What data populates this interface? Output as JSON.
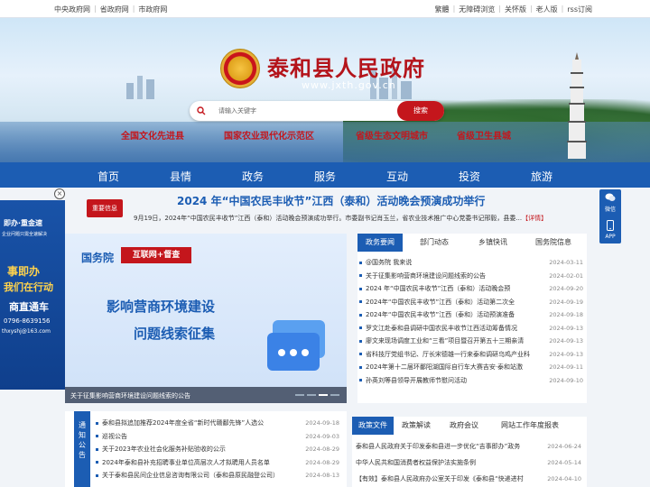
{
  "topbar": {
    "left_links": [
      "中央政府网",
      "省政府网",
      "市政府网"
    ],
    "right_links": [
      "繁體",
      "无障碍浏览",
      "关怀版",
      "老人版",
      "rss订阅"
    ]
  },
  "header": {
    "site_title": "泰和县人民政府",
    "site_url": "www.jxth.gov.cn",
    "search_placeholder": "请输入关键字",
    "search_button": "搜索",
    "slogans": [
      "全国文化先进县",
      "国家农业现代化示范区",
      "省级生态文明城市",
      "省级卫生县城"
    ]
  },
  "nav": {
    "items": [
      "首页",
      "县情",
      "政务",
      "服务",
      "互动",
      "投资",
      "旅游"
    ]
  },
  "left_ad": {
    "line1": "即办·重金速",
    "line2": "企业问题只需全速解决",
    "line3": "事即办",
    "line4": "我们在行动",
    "line5": "商直通车",
    "line6": "0796-8639156",
    "line7": "thxyshj@163.com"
  },
  "headline": {
    "tag": "重要信息",
    "title": "2024 年“中国农民丰收节”江西（泰和）活动晚会预演成功举行",
    "summary": "9月19日，2024年“中国农民丰收节”江西（泰和）活动晚会预演成功举行。市委副书记肖玉兰，省农业技术推广中心党委书记邢毅，县委...",
    "more": "【详情】"
  },
  "banner": {
    "tag1": "国务院",
    "tag2": "互联网+督查",
    "title1": "影响营商环境建设",
    "title2": "问题线索征集",
    "caption": "关于征集影响营商环境建设问题线索的公告"
  },
  "news_panel": {
    "tabs": [
      "政务要闻",
      "部门动态",
      "乡镇快讯",
      "国务院信息"
    ],
    "items": [
      {
        "title": "@国务院 我来说",
        "date": "2024-03-11"
      },
      {
        "title": "关于征集影响营商环境建设问题线索的公告",
        "date": "2024-02-01"
      },
      {
        "title": "2024 年“中国农民丰收节”江西（泰和）活动晚会预",
        "date": "2024-09-20"
      },
      {
        "title": "2024年“中国农民丰收节”江西（泰和）活动第二次全",
        "date": "2024-09-19"
      },
      {
        "title": "2024年“中国农民丰收节”江西（泰和）活动预演准备",
        "date": "2024-09-18"
      },
      {
        "title": "罗文江赴泰和县调研中国农民丰收节江西活动筹备情况",
        "date": "2024-09-13"
      },
      {
        "title": "廖文来现场调度工业和“三看”项目暨召开第五十三期亲清",
        "date": "2024-09-13"
      },
      {
        "title": "省科技厅党组书记、厅长宋德雄一行来泰和调研乌鸡产业科",
        "date": "2024-09-13"
      },
      {
        "title": "2024年第十二届环鄱阳湖国际自行车大赛吉安·泰和站激",
        "date": "2024-09-11"
      },
      {
        "title": "孙英刘等县领导开展教师节慰问活动",
        "date": "2024-09-10"
      }
    ]
  },
  "notice_panel": {
    "tag": "通知公告",
    "items": [
      {
        "title": "泰和县拟追加推荐2024年度全省“新时代赣鄱先锋”人选公",
        "date": "2024-09-18"
      },
      {
        "title": "巡视公告",
        "date": "2024-09-03"
      },
      {
        "title": "关于2023年农业社会化服务补贴验收的公示",
        "date": "2024-08-29"
      },
      {
        "title": "2024年泰和县补充招聘事业单位高层次人才拟聘用人员名单",
        "date": "2024-08-29"
      },
      {
        "title": "关于泰和县民间企业信息咨询有限公司（泰和县原民融登公司）",
        "date": "2024-08-13"
      }
    ]
  },
  "docs_panel": {
    "tabs": [
      "政策文件",
      "政策解读",
      "政府会议",
      "网站工作年度报表"
    ],
    "items": [
      {
        "title": "泰和县人民政府关于印发泰和县进一步优化“吉事即办”政务",
        "date": "2024-06-24"
      },
      {
        "title": "中华人民共和国消费者权益保护法实施条例",
        "date": "2024-05-14"
      },
      {
        "title": "【有效】泰和县人民政府办公室关于印发《泰和县“快递进村",
        "date": "2024-04-10"
      }
    ]
  },
  "float_right": {
    "wechat": "微信",
    "app": "APP"
  },
  "colors": {
    "brand_blue": "#1c5db3",
    "brand_red": "#c4161c"
  }
}
